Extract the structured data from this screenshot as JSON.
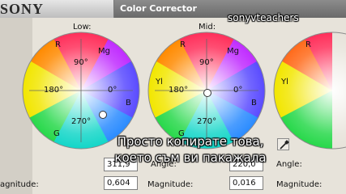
{
  "window": {
    "logo_text": "SONY",
    "title": "Color Corrector",
    "watermark": "sonyvteachers"
  },
  "wheels": {
    "low": {
      "label": "Low:",
      "marks": {
        "r": "R",
        "mg": "Mg",
        "b": "B",
        "g": "G",
        "deg90": "90°",
        "deg180": "180°",
        "deg0": "0°",
        "deg270": "270°"
      },
      "angle_value": "311,9",
      "magnitude_value": "0,604"
    },
    "mid": {
      "label": "Mid:",
      "marks": {
        "r": "R",
        "mg": "Mg",
        "yl": "Yl",
        "b": "B",
        "g": "G",
        "deg90": "90°",
        "deg180": "180°",
        "deg0": "0°",
        "deg270": "270°"
      },
      "angle_value": "220,0",
      "magnitude_value": "0,016"
    },
    "high": {
      "marks": {
        "r": "R",
        "yl": "Yl"
      }
    }
  },
  "fields": {
    "angle_label": "Angle:",
    "magnitude_label_cut": "agnitude:",
    "magnitude_label": "Magnitude:"
  },
  "subtitles": {
    "line1": "Просто копирате това,",
    "line2": "което съм ви пакажала"
  },
  "colors": {
    "titlebar": "#777777",
    "panel": "#e7e3da",
    "wheel_center_white": "#ffffff"
  }
}
